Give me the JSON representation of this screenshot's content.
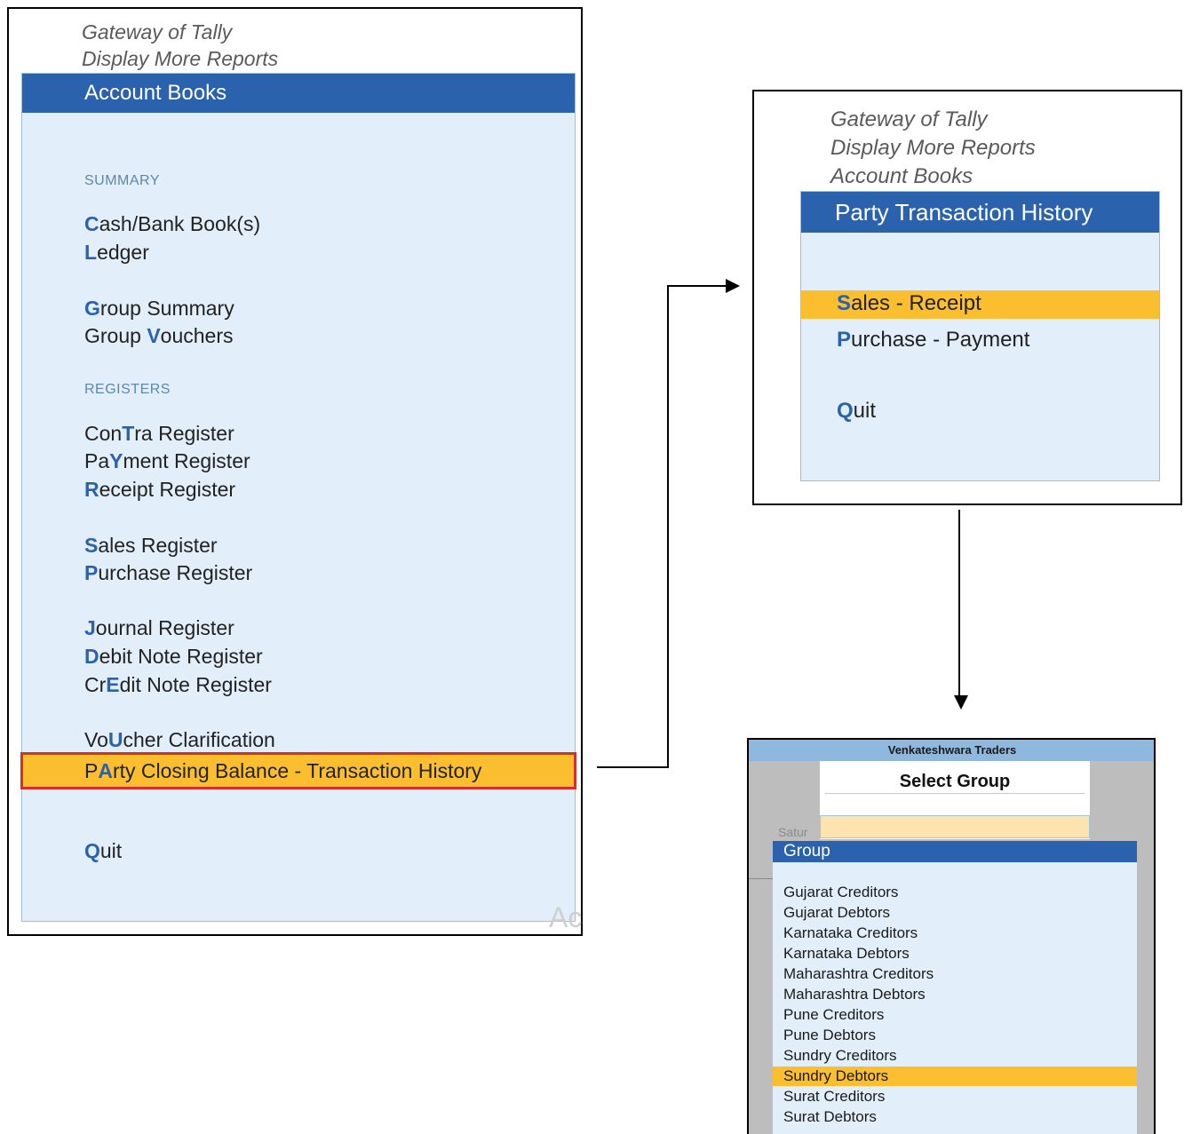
{
  "panel1": {
    "breadcrumb": [
      "Gateway of Tally",
      "Display More Reports"
    ],
    "header": "Account Books",
    "section_summary": "SUMMARY",
    "section_registers": "REGISTERS",
    "items": [
      {
        "pre": "",
        "hk": "C",
        "post": "ash/Bank Book(s)"
      },
      {
        "pre": "",
        "hk": "L",
        "post": "edger"
      },
      {
        "pre": "",
        "hk": "G",
        "post": "roup Summary"
      },
      {
        "pre": "Group ",
        "hk": "V",
        "post": "ouchers"
      },
      {
        "pre": "Con",
        "hk": "T",
        "post": "ra Register"
      },
      {
        "pre": "Pa",
        "hk": "Y",
        "post": "ment Register"
      },
      {
        "pre": "",
        "hk": "R",
        "post": "eceipt Register"
      },
      {
        "pre": "",
        "hk": "S",
        "post": "ales Register"
      },
      {
        "pre": "",
        "hk": "P",
        "post": "urchase Register"
      },
      {
        "pre": "",
        "hk": "J",
        "post": "ournal Register"
      },
      {
        "pre": "",
        "hk": "D",
        "post": "ebit Note Register"
      },
      {
        "pre": "Cr",
        "hk": "E",
        "post": "dit Note Register"
      },
      {
        "pre": "Vo",
        "hk": "U",
        "post": "cher Clarification"
      },
      {
        "pre": "P",
        "hk": "A",
        "post": "rty Closing Balance - Transaction History"
      },
      {
        "pre": "",
        "hk": "Q",
        "post": "uit"
      }
    ],
    "watermark": "Ac"
  },
  "panel2": {
    "breadcrumb": [
      "Gateway of Tally",
      "Display More Reports",
      "Account Books"
    ],
    "header": "Party Transaction History",
    "items": [
      {
        "pre": "",
        "hk": "S",
        "post": "ales - Receipt"
      },
      {
        "pre": "",
        "hk": "P",
        "post": "urchase - Payment"
      },
      {
        "pre": "",
        "hk": "Q",
        "post": "uit"
      }
    ]
  },
  "panel3": {
    "company": "Venkateshwara Traders",
    "dialog_title": "Select Group",
    "input_value": "",
    "behind_text": "Satur",
    "list_header": "Group",
    "groups": [
      "Gujarat Creditors",
      "Gujarat Debtors",
      "Karnataka Creditors",
      "Karnataka Debtors",
      "Maharashtra Creditors",
      "Maharashtra Debtors",
      "Pune Creditors",
      "Pune Debtors",
      "Sundry Creditors",
      "Sundry Debtors",
      "Surat Creditors",
      "Surat Debtors"
    ],
    "selected_group": "Sundry Debtors"
  },
  "colors": {
    "header_blue": "#2a62ad",
    "panel_bg": "#e2eef9",
    "highlight": "#fbbe2e",
    "hotkey_blue": "#2a62ad",
    "selection_outline": "#d32f2f"
  }
}
